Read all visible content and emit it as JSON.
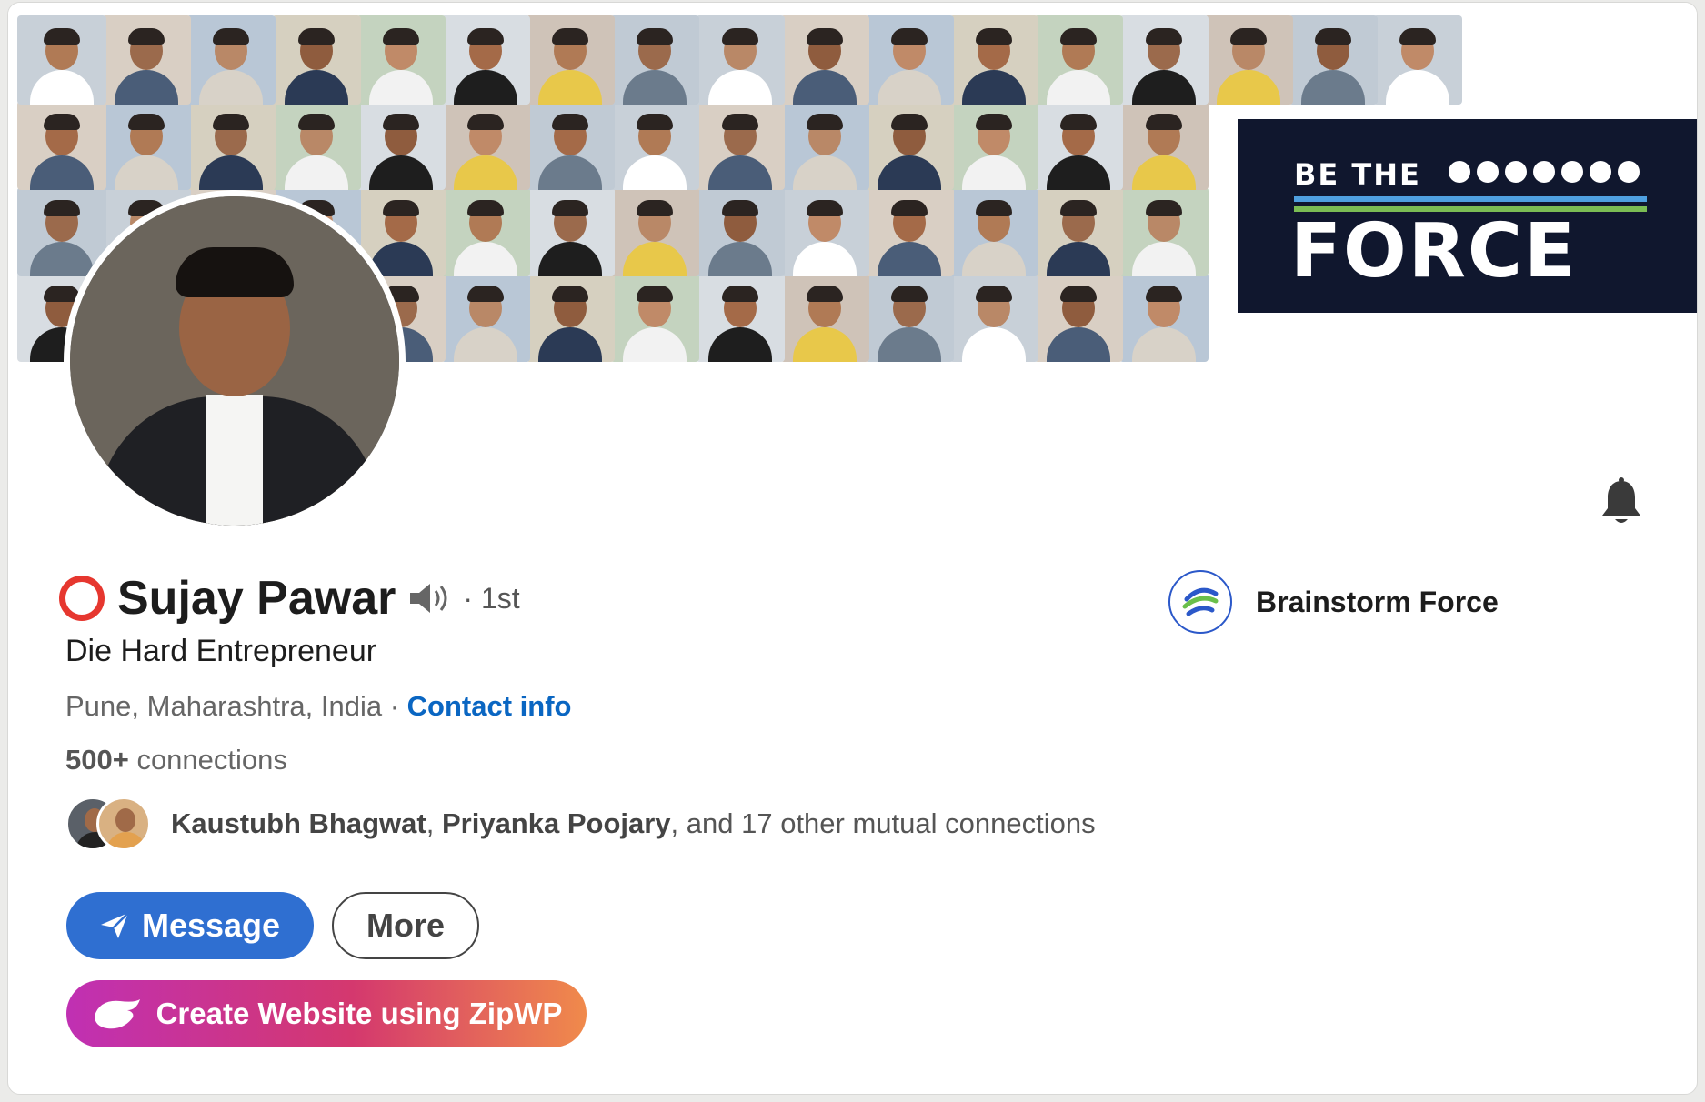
{
  "banner": {
    "headline_small": "BE THE",
    "headline_big": "FORCE"
  },
  "profile": {
    "name": "Sujay Pawar",
    "degree": "· 1st",
    "headline": "Die Hard Entrepreneur",
    "location": "Pune, Maharashtra, India",
    "separator": " · ",
    "contact_info_label": "Contact info",
    "connections_count": "500+",
    "connections_label": " connections"
  },
  "company": {
    "name": "Brainstorm Force"
  },
  "mutual": {
    "name1": "Kaustubh Bhagwat",
    "comma": ", ",
    "name2": "Priyanka Poojary",
    "rest": ", and 17 other mutual connections"
  },
  "actions": {
    "message_label": "Message",
    "more_label": "More",
    "zipwp_label": "Create Website using ZipWP"
  },
  "colors": {
    "primary_blue": "#2f6fd1",
    "link_blue": "#0a66c2",
    "status_ring_red": "#e6372f",
    "banner_dark": "#10172e"
  },
  "icons": {
    "status": "red-ring-icon",
    "pronunciation": "speaker-icon",
    "notifications": "bell-icon",
    "message": "paper-plane-icon",
    "zipwp": "zipwp-logo-icon"
  }
}
